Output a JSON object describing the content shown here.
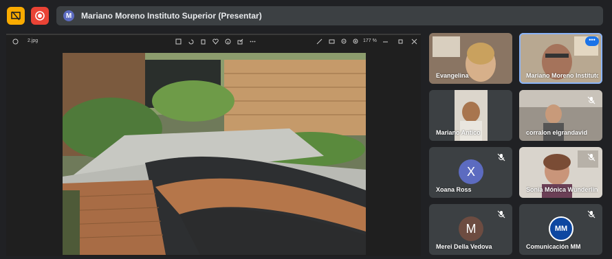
{
  "presenter": {
    "avatar_letter": "M",
    "title": "Mariano Moreno Instituto Superior (Presentar)"
  },
  "viewer": {
    "filename": "2.jpg",
    "zoom": "177 %"
  },
  "participants": [
    {
      "name": "Evangelina",
      "muted": false,
      "type": "video"
    },
    {
      "name": "Mariano Moreno Instituto Superior",
      "muted": false,
      "type": "video",
      "selected": true
    },
    {
      "name": "Mariano Antico",
      "muted": false,
      "type": "video"
    },
    {
      "name": "corralon elgrandavid",
      "muted": true,
      "type": "video"
    },
    {
      "name": "Xoana Ross",
      "muted": true,
      "type": "avatar",
      "letter": "X",
      "color": "#5c6bc0"
    },
    {
      "name": "Sonia Mónica Wunderlin",
      "muted": true,
      "type": "video"
    },
    {
      "name": "Merei Della Vedova",
      "muted": true,
      "type": "avatar",
      "letter": "M",
      "color": "#6d4c41"
    },
    {
      "name": "Comunicación MM",
      "muted": true,
      "type": "logo",
      "logo_text": "MM"
    }
  ],
  "colors": {
    "accent": "#8ab4f8",
    "present_icon": "#f9ab00",
    "record_icon": "#ea4335"
  }
}
